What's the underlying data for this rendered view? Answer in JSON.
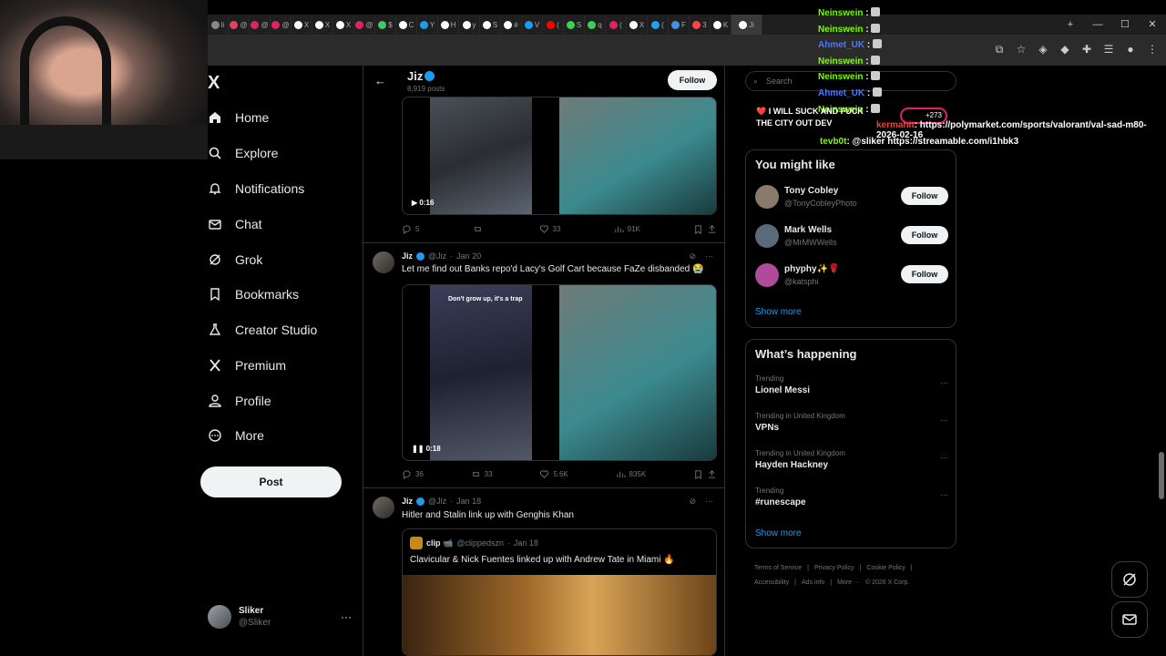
{
  "browser": {
    "tabs": [
      "li",
      "@",
      "@",
      "@",
      "X",
      "X",
      "X",
      "@",
      "$",
      "C",
      "Y",
      "H",
      "y",
      "S",
      "#",
      "V",
      "(",
      "S",
      "q",
      "(",
      "X",
      "(",
      "F",
      "3",
      "K",
      "Ji"
    ],
    "tab_colors": [
      "#888",
      "#e4405f",
      "#e0245e",
      "#e0245e",
      "#fff",
      "#fff",
      "#fff",
      "#e0245e",
      "#44c767",
      "#fff",
      "#1d9bf0",
      "#fff",
      "#fff",
      "#fff",
      "#fff",
      "#1d9bf0",
      "#ff0000",
      "#39d353",
      "#39d353",
      "#e0245e",
      "#fff",
      "#1da1f2",
      "#4a90e2",
      "#ff4444",
      "#fff",
      "#fff"
    ],
    "window_buttons": [
      "+",
      "—",
      "☐",
      "✕"
    ]
  },
  "nav": {
    "logo": "X",
    "items": [
      {
        "label": "Home",
        "icon": "home-icon"
      },
      {
        "label": "Explore",
        "icon": "search-icon"
      },
      {
        "label": "Notifications",
        "icon": "bell-icon"
      },
      {
        "label": "Chat",
        "icon": "mail-icon"
      },
      {
        "label": "Grok",
        "icon": "grok-icon"
      },
      {
        "label": "Bookmarks",
        "icon": "bookmark-icon"
      },
      {
        "label": "Creator Studio",
        "icon": "flask-icon"
      },
      {
        "label": "Premium",
        "icon": "x-logo-icon"
      },
      {
        "label": "Profile",
        "icon": "person-icon"
      },
      {
        "label": "More",
        "icon": "more-circle-icon"
      }
    ],
    "post_label": "Post",
    "account": {
      "name": "Sliker",
      "handle": "@Sliker",
      "more": "···"
    }
  },
  "header": {
    "back": "←",
    "name": "Jiz",
    "posts": "8,919 posts",
    "follow_label": "Follow"
  },
  "tweets": [
    {
      "media_duration": "0:16",
      "replies": "5",
      "retweets": "",
      "likes": "33",
      "views": "91K"
    },
    {
      "name": "Jiz",
      "handle": "@Jiz",
      "date": "Jan 20",
      "text": "Let me find out Banks repo'd Lacy's Golf Cart because FaZe disbanded 😭",
      "media_caption": "Don't grow up, it's a trap",
      "media_duration": "0:18",
      "replies": "36",
      "retweets": "33",
      "likes": "5.6K",
      "views": "835K"
    },
    {
      "name": "Jiz",
      "handle": "@Jiz",
      "date": "Jan 18",
      "text": "Hitler and Stalin link up with Genghis Khan",
      "quote": {
        "name": "clip 📹",
        "handle": "@clippedszn",
        "date": "Jan 18",
        "text": "Clavicular & Nick Fuentes linked up with Andrew Tate in Miami 🔥"
      }
    }
  ],
  "right": {
    "search_placeholder": "Search",
    "you_might_like": {
      "title": "You might like",
      "users": [
        {
          "name": "Tony Cobley",
          "handle": "@TonyCobleyPhoto",
          "follow": "Follow",
          "color": "#8a7a6a"
        },
        {
          "name": "Mark Wells",
          "handle": "@MrMWWells",
          "follow": "Follow",
          "color": "#5a6a7a"
        },
        {
          "name": "phyphy✨🌹",
          "handle": "@katsphi",
          "follow": "Follow",
          "color": "#b04a9a"
        }
      ],
      "show_more": "Show more"
    },
    "happening": {
      "title": "What’s happening",
      "trends": [
        {
          "context": "Trending",
          "name": "Lionel Messi"
        },
        {
          "context": "Trending in United Kingdom",
          "name": "VPNs"
        },
        {
          "context": "Trending in United Kingdom",
          "name": "Hayden Hackney"
        },
        {
          "context": "Trending",
          "name": "#runescape"
        }
      ],
      "more": "···",
      "show_more": "Show more"
    },
    "footer": [
      "Terms of Service",
      "|",
      "Privacy Policy",
      "|",
      "Cookie Policy",
      "|",
      "Accessibility",
      "|",
      "Ads info",
      "|",
      "More ···",
      "© 2026 X Corp."
    ]
  },
  "chat": {
    "rows": [
      {
        "user": "Neinswein",
        "color": "u1",
        "msg": ":"
      },
      {
        "user": "Neinswein",
        "color": "u1",
        "msg": ":"
      },
      {
        "user": "Ahmet_UK",
        "color": "u2",
        "msg": ":"
      },
      {
        "user": "Neinswein",
        "color": "u1",
        "msg": ":"
      },
      {
        "user": "Neinswein",
        "color": "u1",
        "msg": ":"
      },
      {
        "user": "Ahmet_UK",
        "color": "u2",
        "msg": ":"
      },
      {
        "user": "Neinswein",
        "color": "u1",
        "msg": ":"
      }
    ],
    "overlay_line1": "❤️ I WILL SUCK AND FUCK",
    "overlay_line2": "THE CITY OUT DEV",
    "bubble": "+273",
    "hidden_user": "Ahmet_UK",
    "poly_user": "kermahit",
    "poly_text": ": https://polymarket.com/sports/valorant/val-sad-m80-2026-02-16",
    "tevb_user": "tevb0t",
    "tevb_text": ": @sliker https://streamable.com/i1hbk3"
  }
}
